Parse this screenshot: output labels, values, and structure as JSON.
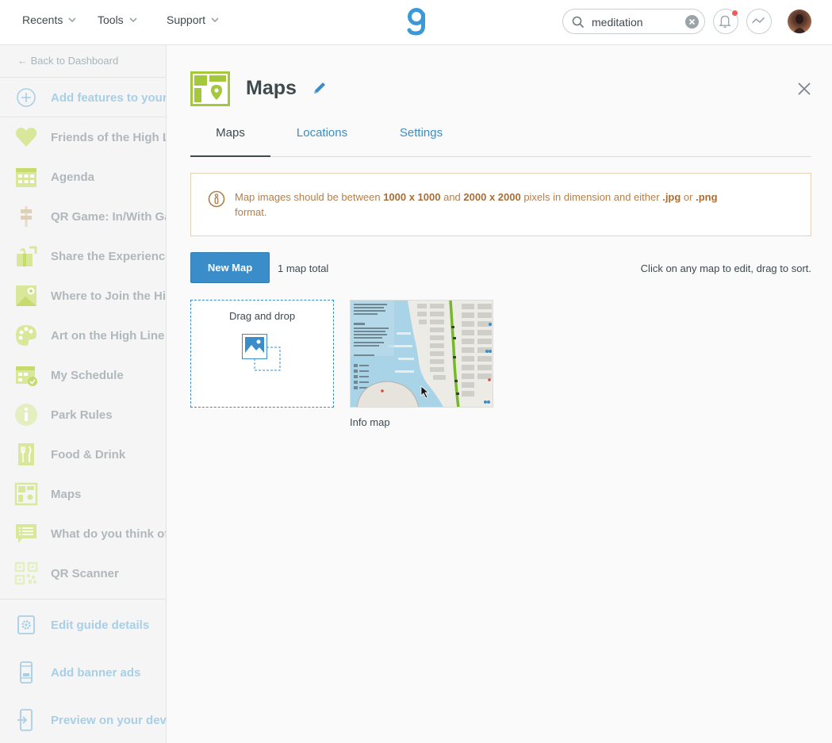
{
  "topnav": {
    "recents": "Recents",
    "tools": "Tools",
    "support": "Support",
    "search_value": "meditation"
  },
  "sidebar": {
    "back_link": "← Back to Dashboard",
    "items": [
      {
        "label": "Add features to your guide",
        "icon": "plus-circle-icon"
      },
      {
        "label": "Friends of the High Line",
        "icon": "heart-icon"
      },
      {
        "label": "Agenda",
        "icon": "calendar-icon"
      },
      {
        "label": "QR Game: In/With Gardens",
        "icon": "signpost-icon"
      },
      {
        "label": "Share the Experience",
        "icon": "gift-share-icon"
      },
      {
        "label": "Where to Join the High Line",
        "icon": "map-pin-icon"
      },
      {
        "label": "Art on the High Line",
        "icon": "palette-icon"
      },
      {
        "label": "My Schedule",
        "icon": "calendar-check-icon"
      },
      {
        "label": "Park Rules",
        "icon": "info-icon"
      },
      {
        "label": "Food & Drink",
        "icon": "fork-knife-icon"
      },
      {
        "label": "Maps",
        "icon": "maps-icon"
      },
      {
        "label": "What do you think of the High Line?",
        "icon": "feedback-icon"
      },
      {
        "label": "QR Scanner",
        "icon": "qr-code-icon"
      }
    ],
    "footer_items": [
      {
        "label": "Edit guide details",
        "icon": "gear-icon"
      },
      {
        "label": "Add banner ads",
        "icon": "phone-icon"
      },
      {
        "label": "Preview on your device",
        "icon": "device-preview-icon"
      }
    ]
  },
  "main": {
    "title": "Maps",
    "tabs": [
      "Maps",
      "Locations",
      "Settings"
    ],
    "active_tab": 0,
    "notice": {
      "t1": "Map images should be between ",
      "b1": "1000 x 1000",
      "t2": " and ",
      "b2": "2000 x 2000",
      "t3": " pixels in dimension and either ",
      "b3": ".jpg",
      "t4": " or ",
      "b4": ".png",
      "t5": " format."
    },
    "new_map_label": "New Map",
    "map_count": "1 map total",
    "hint": "Click on any map to edit, drag to sort.",
    "dropzone_label": "Drag and drop",
    "maps": [
      {
        "caption": "Info map"
      }
    ]
  },
  "colors": {
    "accent_blue": "#3a8dc8",
    "brand_green": "#a5c73b",
    "notice_text": "#b27f4e",
    "notification_dot": "#ef5a5a"
  }
}
